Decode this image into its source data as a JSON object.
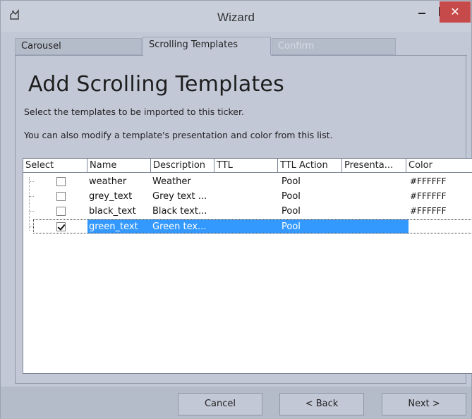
{
  "window": {
    "title": "Wizard",
    "close_glyph": "✕"
  },
  "tabs": [
    {
      "label": "Carousel"
    },
    {
      "label": "Scrolling Templates"
    },
    {
      "label": "Confirm"
    }
  ],
  "main": {
    "title": "Add Scrolling Templates",
    "description_1": "Select the templates to be imported to this ticker.",
    "description_2": "You can also modify a template's presentation and color from this list."
  },
  "grid": {
    "columns": [
      "Select",
      "Name",
      "Description",
      "TTL",
      "TTL Action",
      "Presenta...",
      "Color"
    ],
    "rows": [
      {
        "checked": false,
        "name": "weather",
        "description": "Weather",
        "ttl": "",
        "ttl_action": "Pool",
        "presentation": "",
        "color": "#FFFFFF",
        "selected": false
      },
      {
        "checked": false,
        "name": "grey_text",
        "description": "Grey text ...",
        "ttl": "",
        "ttl_action": "Pool",
        "presentation": "",
        "color": "#FFFFFF",
        "selected": false
      },
      {
        "checked": false,
        "name": "black_text",
        "description": "Black text...",
        "ttl": "",
        "ttl_action": "Pool",
        "presentation": "",
        "color": "#FFFFFF",
        "selected": false
      },
      {
        "checked": true,
        "name": "green_text",
        "description": "Green tex...",
        "ttl": "",
        "ttl_action": "Pool",
        "presentation": "",
        "color": "",
        "selected": true
      }
    ]
  },
  "footer": {
    "cancel_label": "Cancel",
    "back_label": "< Back",
    "next_label": "Next >"
  },
  "colors": {
    "selection": "#3399ff",
    "close_button": "#c74a4a",
    "panel": "#c2c8d6"
  }
}
